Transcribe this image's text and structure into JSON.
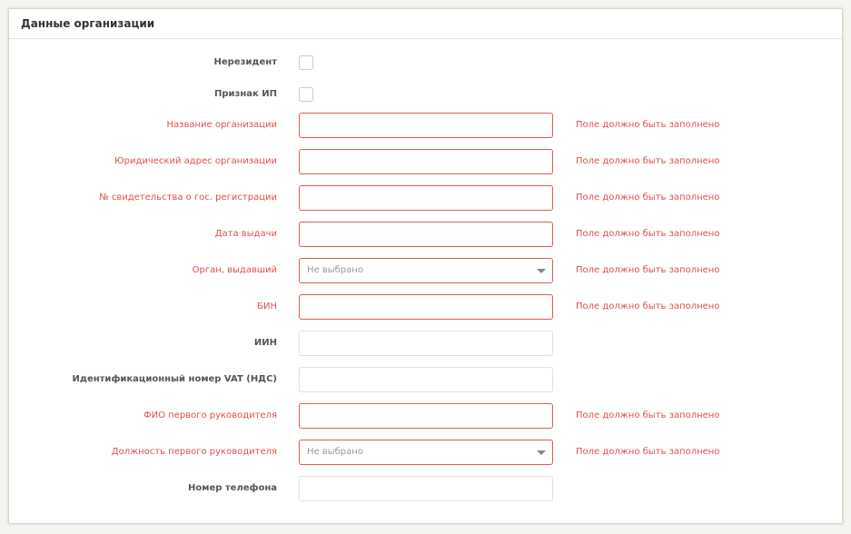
{
  "panel": {
    "title": "Данные организации"
  },
  "fields": {
    "nonresident": {
      "label": "Нерезидент"
    },
    "ip_flag": {
      "label": "Признак ИП"
    },
    "org_name": {
      "label": "Название организации",
      "value": "",
      "error": "Поле должно быть заполнено"
    },
    "legal_address": {
      "label": "Юридический адрес организации",
      "value": "",
      "error": "Поле должно быть заполнено"
    },
    "reg_cert": {
      "label": "№ свидетельства о гос. регистрации",
      "value": "",
      "error": "Поле должно быть заполнено"
    },
    "issue_date": {
      "label": "Дата выдачи",
      "value": "",
      "error": "Поле должно быть заполнено"
    },
    "issuer": {
      "label": "Орган, выдавший",
      "selected": "Не выбрано",
      "error": "Поле должно быть заполнено"
    },
    "bin": {
      "label": "БИН",
      "value": "",
      "error": "Поле должно быть заполнено"
    },
    "iin": {
      "label": "ИИН",
      "value": ""
    },
    "vat": {
      "label": "Идентификационный номер VAT (НДС)",
      "value": ""
    },
    "director_name": {
      "label": "ФИО первого руководителя",
      "value": "",
      "error": "Поле должно быть заполнено"
    },
    "director_position": {
      "label": "Должность первого руководителя",
      "selected": "Не выбрано",
      "error": "Поле должно быть заполнено"
    },
    "phone": {
      "label": "Номер телефона",
      "value": ""
    }
  },
  "colors": {
    "error": "#e0504d",
    "border": "#dfe2dc",
    "background": "#f4f5f0"
  }
}
